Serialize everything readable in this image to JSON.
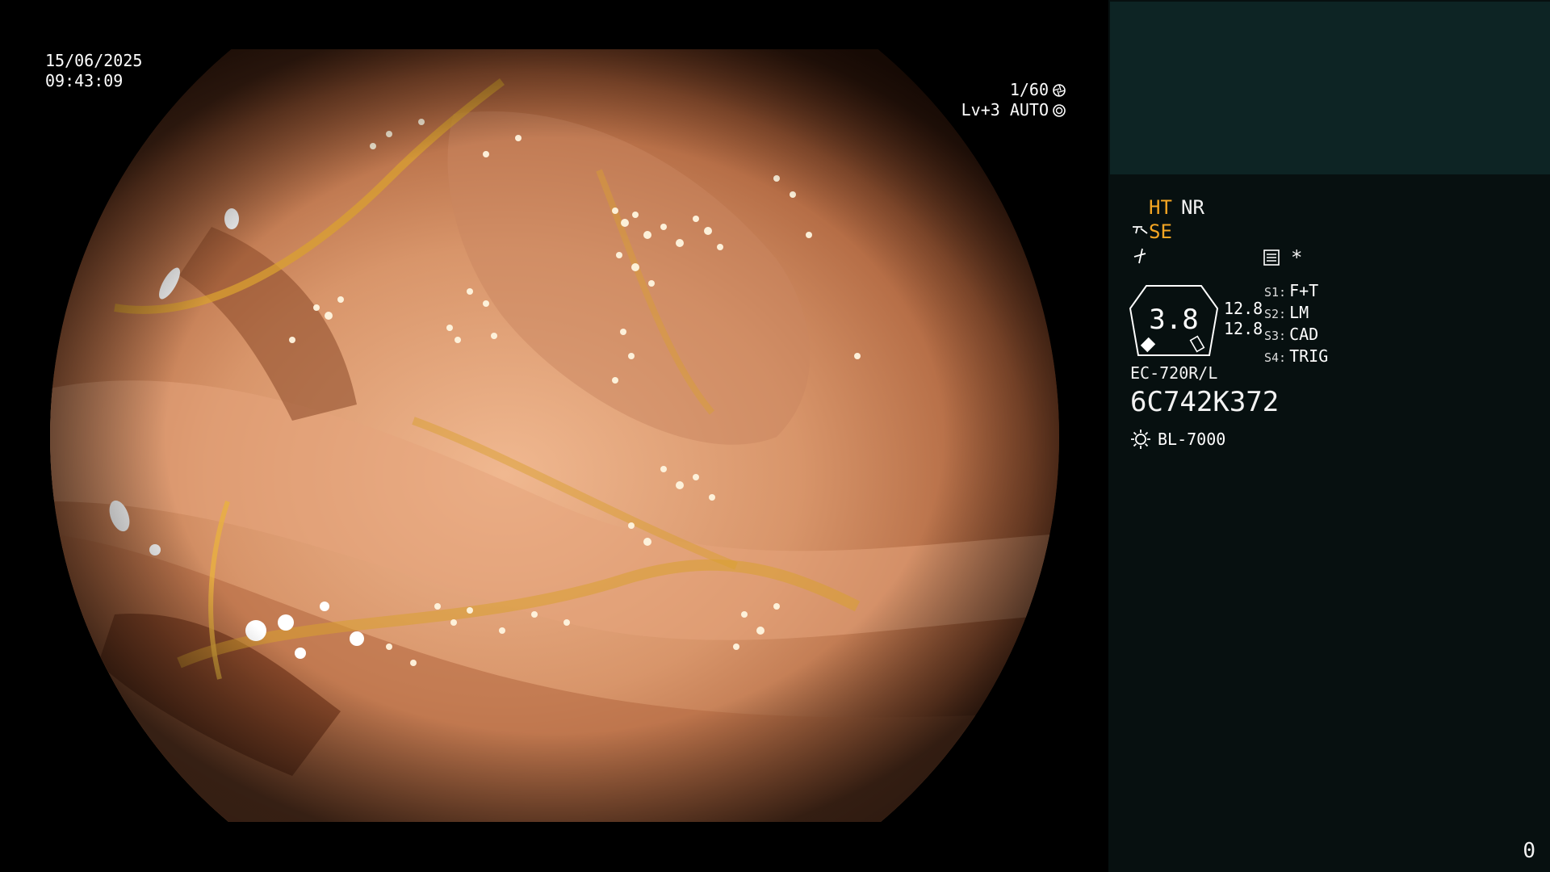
{
  "osd": {
    "date": "15/06/2025",
    "time": "09:43:09",
    "shutter": "1/60",
    "level": "Lv+3 AUTO"
  },
  "panel": {
    "ht": "HT",
    "nr": "NR",
    "se": "SE",
    "star": "*",
    "zoom": "3.8",
    "iris_values": [
      "12.8",
      "12.8"
    ],
    "switches": [
      {
        "id": "S1:",
        "label": "F+T"
      },
      {
        "id": "S2:",
        "label": "LM"
      },
      {
        "id": "S3:",
        "label": "CAD"
      },
      {
        "id": "S4:",
        "label": "TRIG"
      }
    ],
    "scope_model": "EC-720R/L",
    "serial": "6C742K372",
    "light_source": "BL-7000",
    "counter": "0"
  },
  "colors": {
    "accent_orange": "#f5a623",
    "panel_bg": "#071010",
    "panel_top_bg": "#0d2424",
    "tissue_base": "#c8845a",
    "bile": "#d9a030"
  },
  "icons": [
    "aperture-icon",
    "iris-icon",
    "se-mode-icon",
    "enhance-icon",
    "memo-icon",
    "light-icon"
  ]
}
